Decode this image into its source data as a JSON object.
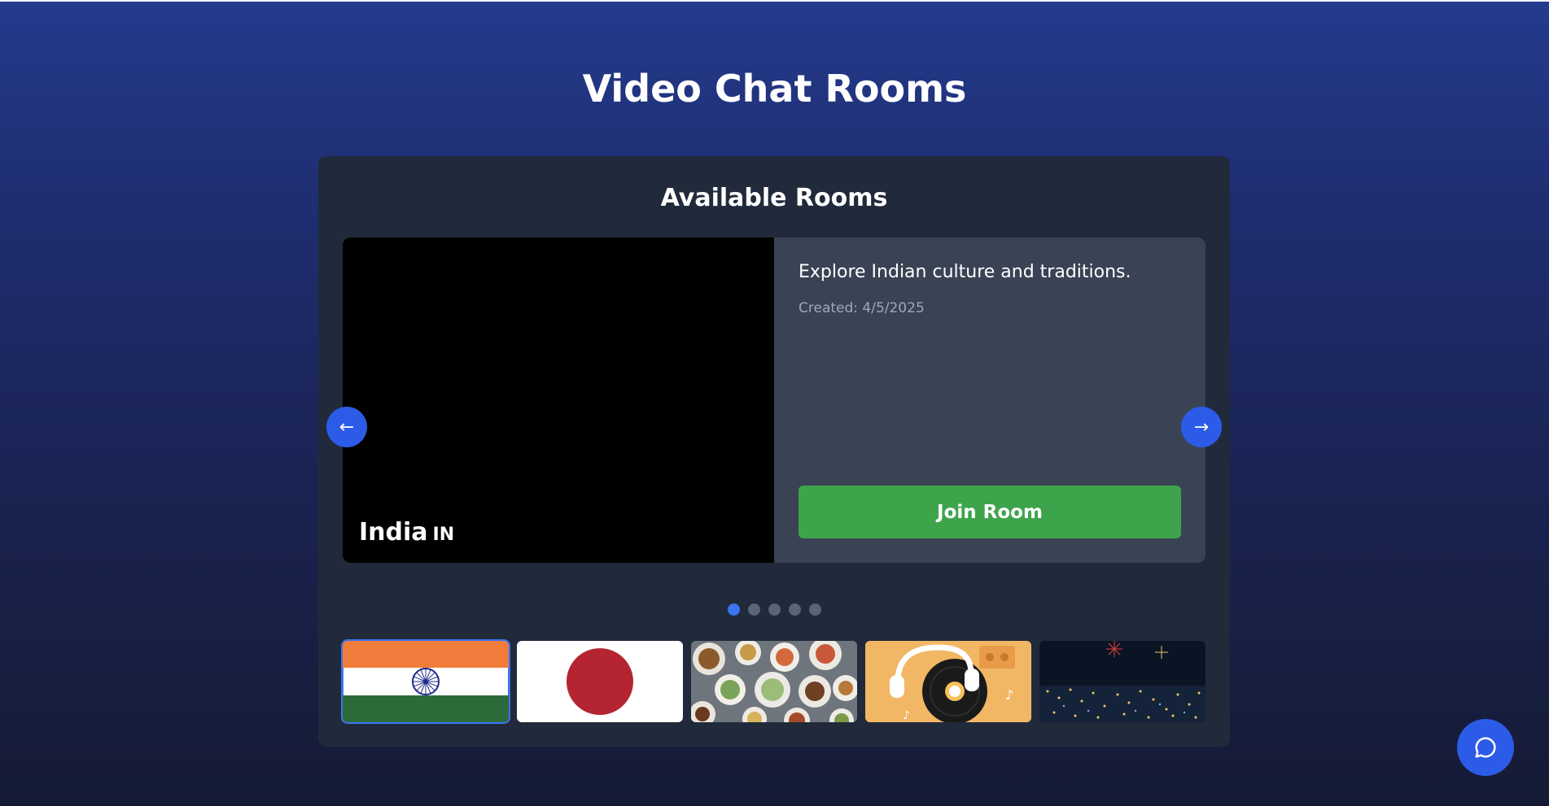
{
  "page": {
    "title": "Video Chat Rooms"
  },
  "rooms_panel": {
    "title": "Available Rooms",
    "active_room": {
      "name": "India",
      "code": "IN",
      "description": "Explore Indian culture and traditions.",
      "created": "Created: 4/5/2025",
      "join_label": "Join Room"
    },
    "prev_arrow": "←",
    "next_arrow": "→",
    "dots": {
      "count": 5,
      "active_index": 0
    },
    "thumbnails": [
      {
        "name": "india-flag",
        "active": true
      },
      {
        "name": "japan-flag",
        "active": false
      },
      {
        "name": "food",
        "active": false
      },
      {
        "name": "music",
        "active": false
      },
      {
        "name": "city-fireworks",
        "active": false
      }
    ]
  },
  "chat_fab": {
    "icon": "chat-bubble-icon"
  },
  "colors": {
    "accent": "#2c5be8",
    "join": "#3ea44c",
    "panel": "#202a3b",
    "info": "#394354"
  }
}
